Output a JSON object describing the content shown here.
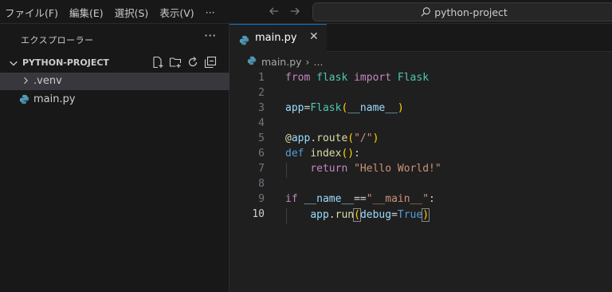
{
  "titlebar": {
    "menu": [
      "ファイル(F)",
      "編集(E)",
      "選択(S)",
      "表示(V)"
    ],
    "more": "···",
    "search_text": "python-project"
  },
  "sidebar": {
    "header": "エクスプローラー",
    "more": "···",
    "project": "PYTHON-PROJECT",
    "items": [
      {
        "label": ".venv",
        "type": "folder"
      },
      {
        "label": "main.py",
        "type": "python-file"
      }
    ]
  },
  "tabs": [
    {
      "label": "main.py",
      "close": "✕"
    }
  ],
  "breadcrumb": {
    "file": "main.py",
    "sep": "›",
    "rest": "..."
  },
  "editor": {
    "lines": [
      "1",
      "2",
      "3",
      "4",
      "5",
      "6",
      "7",
      "8",
      "9",
      "10"
    ],
    "code": [
      "from flask import Flask",
      "",
      "app=Flask(__name__)",
      "",
      "@app.route(\"/\")",
      "def index():",
      "    return \"Hello World!\"",
      "",
      "if __name__==\"__main__\":",
      "    app.run(debug=True)"
    ],
    "current_line": "10"
  },
  "colors": {
    "accent": "#0078d4",
    "keyword": "#c586c0",
    "class": "#4ec9b0",
    "function": "#dcdcaa",
    "variable": "#9cdcfe",
    "string": "#ce9178"
  }
}
